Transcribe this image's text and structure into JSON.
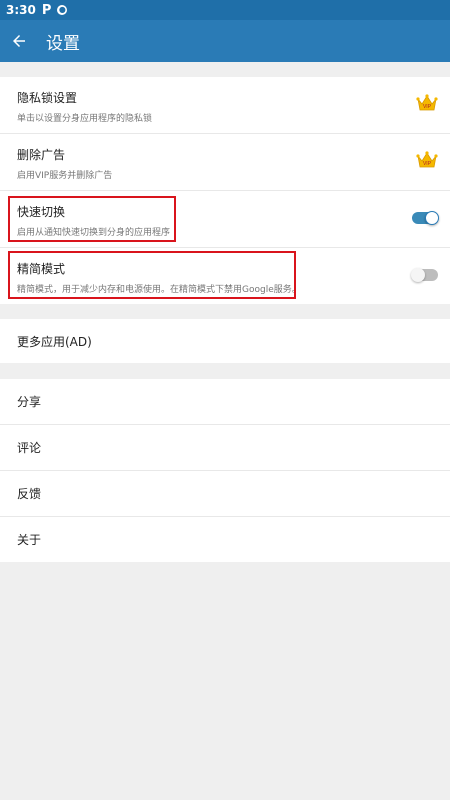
{
  "status_bar": {
    "time": "3:30",
    "p_icon": "P"
  },
  "app_bar": {
    "title": "设置"
  },
  "settings": [
    {
      "title": "隐私锁设置",
      "subtitle": "单击以设置分身应用程序的隐私锁",
      "trailing": "vip-crown-icon"
    },
    {
      "title": "删除广告",
      "subtitle": "启用VIP服务并删除广告",
      "trailing": "vip-crown-icon"
    },
    {
      "title": "快速切换",
      "subtitle": "启用从通知快速切换到分身的应用程序",
      "toggle_on": true
    },
    {
      "title": "精简模式",
      "subtitle": "精简模式，用于减少内存和电源使用。在精简模式下禁用Google服务。",
      "toggle_on": false
    }
  ],
  "more_apps": "更多应用(AD)",
  "menu": [
    "分享",
    "评论",
    "反馈",
    "关于"
  ],
  "crown_text": "VIP",
  "colors": {
    "appbar": "#2a7bb6",
    "statusbar": "#1f6fa9",
    "highlight": "#d9141c",
    "toggle_on": "#3a8ab8"
  }
}
